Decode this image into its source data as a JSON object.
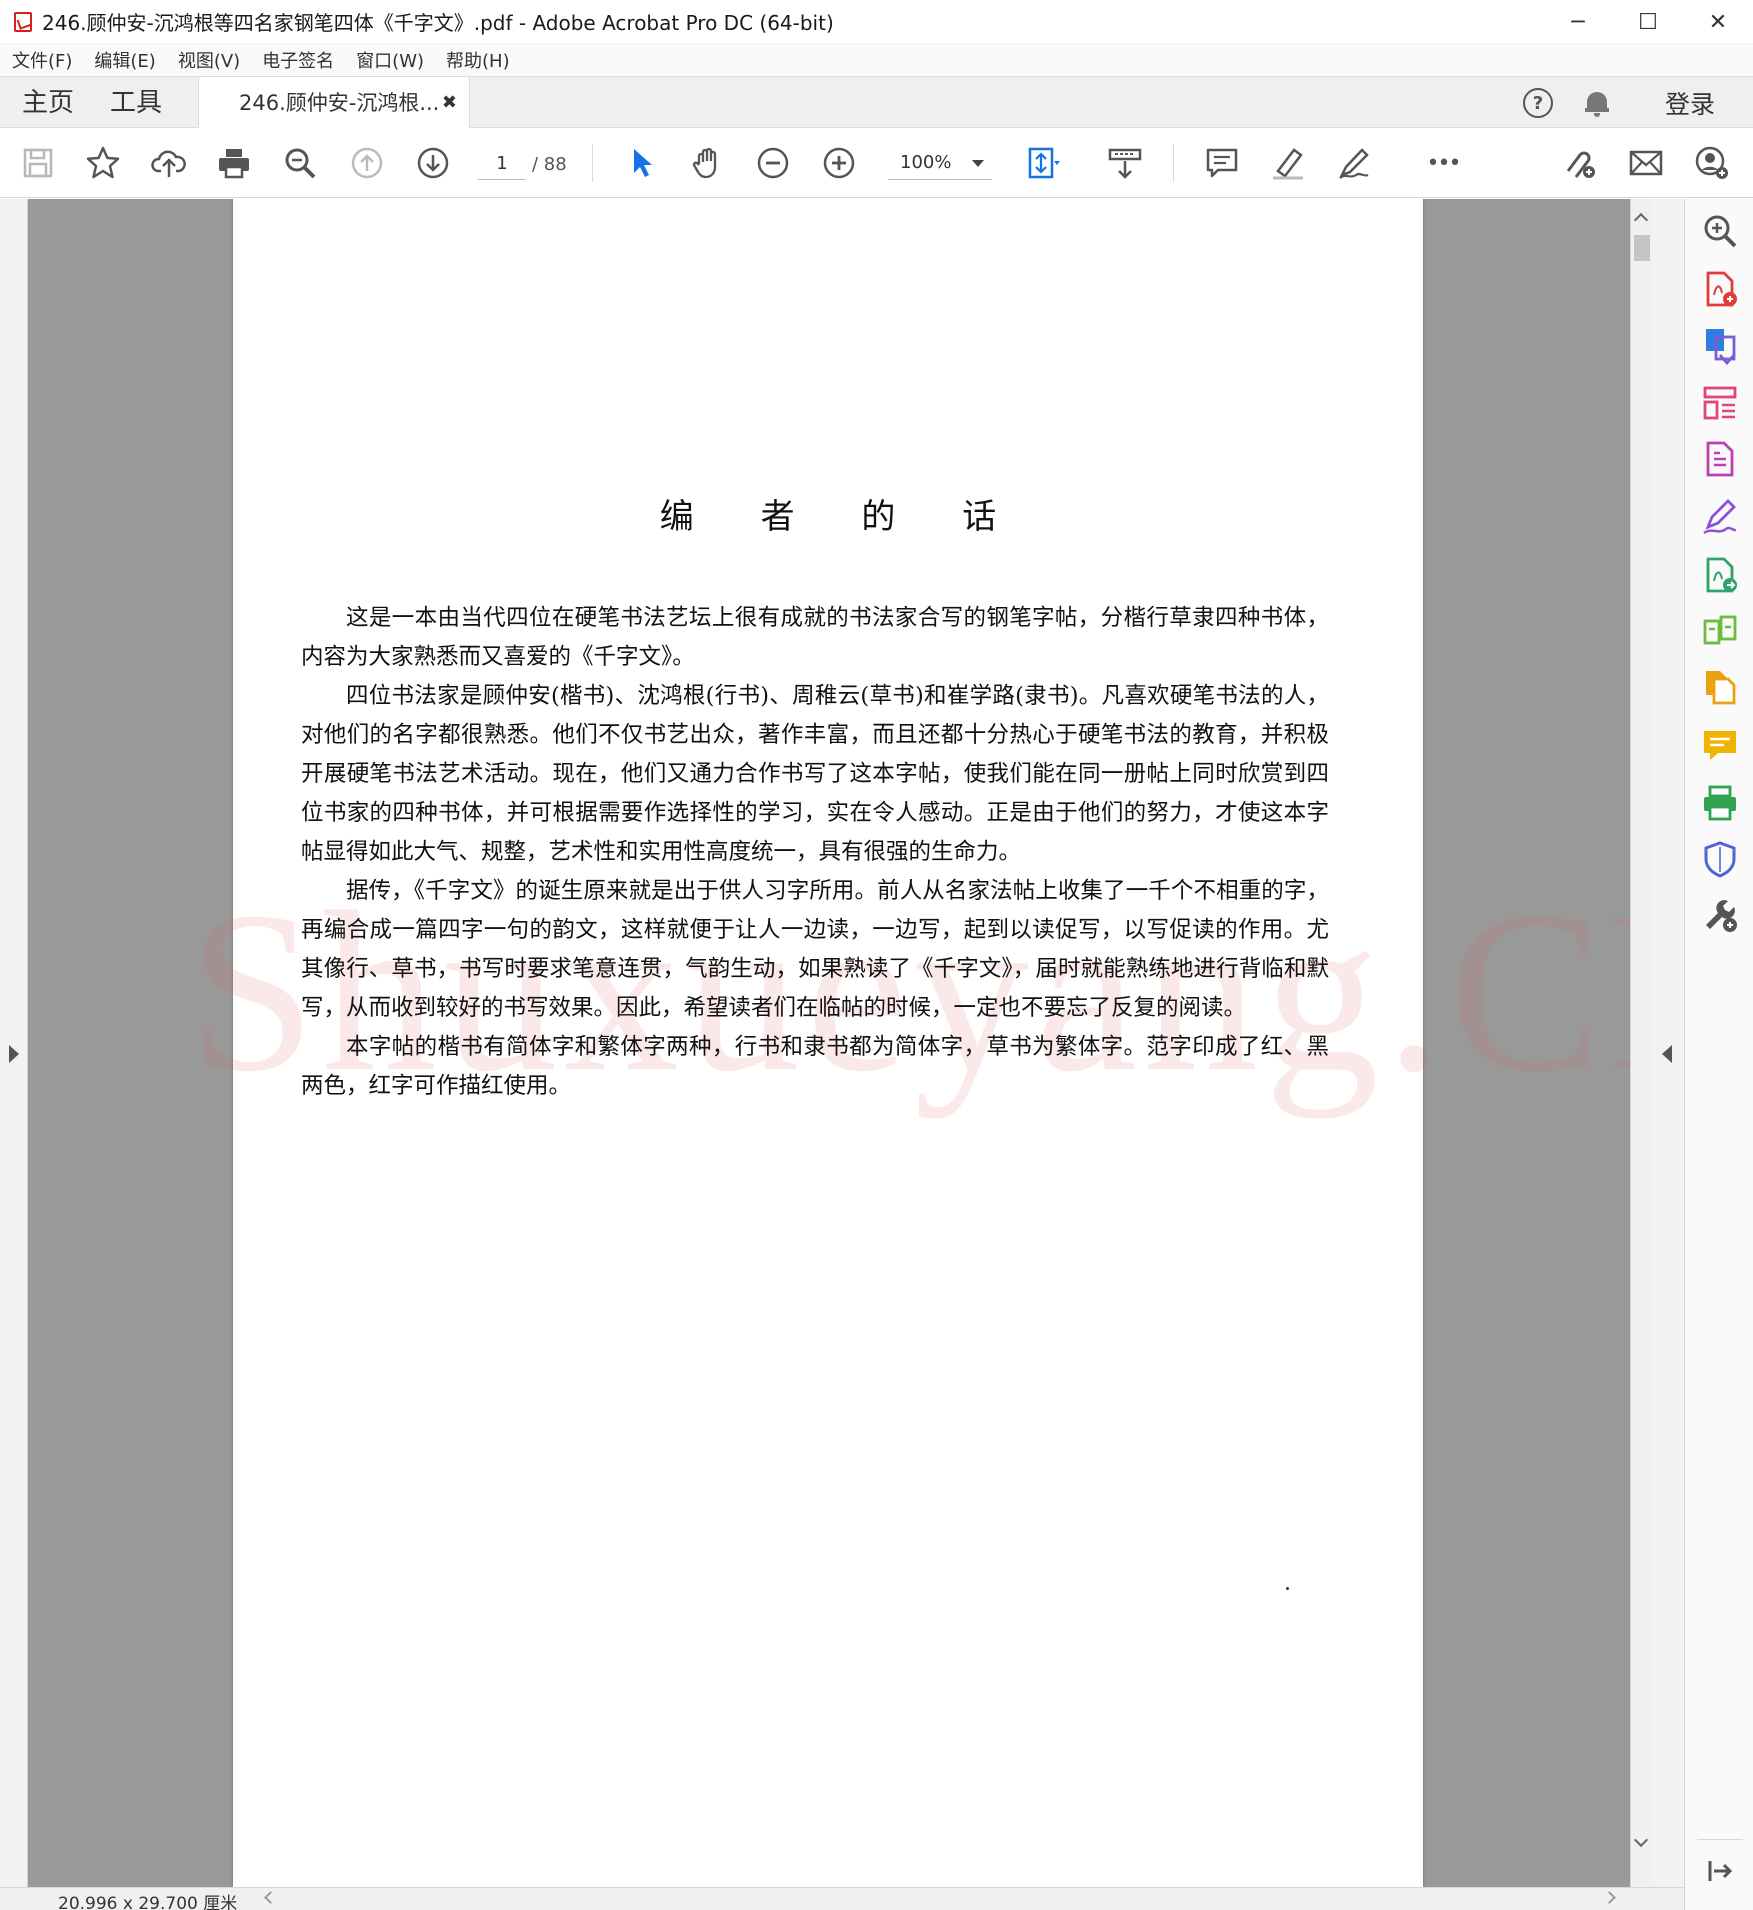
{
  "window": {
    "title": "246.顾仲安-沉鸿根等四名家钢笔四体《千字文》.pdf - Adobe Acrobat Pro DC (64-bit)",
    "minimize_glyph": "─",
    "maximize_glyph": "☐",
    "close_glyph": "✕"
  },
  "menu": [
    "文件(F)",
    "编辑(E)",
    "视图(V)",
    "电子签名",
    "窗口(W)",
    "帮助(H)"
  ],
  "tabs": {
    "home": "主页",
    "tools": "工具",
    "document": "246.顾仲安-沉鸿根...",
    "close_glyph": "✖",
    "help_glyph": "?",
    "login": "登录"
  },
  "toolbar": {
    "current_page": "1",
    "total_pages": "/ 88",
    "zoom": "100%",
    "more_glyph": "•••",
    "icons": [
      "save-icon",
      "star-icon",
      "cloud-upload-icon",
      "print-icon",
      "zoom-search-icon",
      "page-up-icon",
      "page-down-icon",
      "select-arrow-icon",
      "hand-icon",
      "zoom-out-icon",
      "zoom-in-icon",
      "fit-page-icon",
      "scroll-mode-icon",
      "comment-icon",
      "highlight-icon",
      "sign-icon",
      "more-icon",
      "share-link-icon",
      "email-icon",
      "add-user-icon"
    ],
    "accent": "#1473e6"
  },
  "document": {
    "heading": "编 者 的 话",
    "paragraphs": [
      "这是一本由当代四位在硬笔书法艺坛上很有成就的书法家合写的钢笔字帖，分楷行草隶四种书体，内容为大家熟悉而又喜爱的《千字文》。",
      "四位书法家是顾仲安(楷书)、沈鸿根(行书)、周稚云(草书)和崔学路(隶书)。凡喜欢硬笔书法的人，对他们的名字都很熟悉。他们不仅书艺出众，著作丰富，而且还都十分热心于硬笔书法的教育，并积极开展硬笔书法艺术活动。现在，他们又通力合作书写了这本字帖，使我们能在同一册帖上同时欣赏到四位书家的四种书体，并可根据需要作选择性的学习，实在令人感动。正是由于他们的努力，才使这本字帖显得如此大气、规整，艺术性和实用性高度统一，具有很强的生命力。",
      "据传，《千字文》的诞生原来就是出于供人习字所用。前人从名家法帖上收集了一千个不相重的字，再编合成一篇四字一句的韵文，这样就便于让人一边读，一边写，起到以读促写，以写促读的作用。尤其像行、草书，书写时要求笔意连贯，气韵生动，如果熟读了《千字文》，届时就能熟练地进行背临和默写，从而收到较好的书写效果。因此，希望读者们在临帖的时候，一定也不要忘了反复的阅读。",
      "本字帖的楷书有简体字和繁体字两种，行书和隶书都为简体字，草书为繁体字。范字印成了红、黑两色，红字可作描红使用。"
    ],
    "watermark": "Shuxueyang.CN"
  },
  "right_pane": {
    "icons": [
      {
        "name": "enhance-scan-icon",
        "color": "#555555"
      },
      {
        "name": "create-pdf-icon",
        "color": "#e03c3c"
      },
      {
        "name": "export-pdf-icon",
        "color": "#7b5bd6"
      },
      {
        "name": "organize-pages-icon",
        "color": "#e0457b"
      },
      {
        "name": "edit-pdf-icon",
        "color": "#c03fb5"
      },
      {
        "name": "fill-sign-icon",
        "color": "#8f4fd6"
      },
      {
        "name": "export-file-icon",
        "color": "#2fa36b"
      },
      {
        "name": "compare-files-icon",
        "color": "#6dbb3f"
      },
      {
        "name": "combine-files-icon",
        "color": "#e8a30f"
      },
      {
        "name": "comment-tool-icon",
        "color": "#f0b400"
      },
      {
        "name": "print-production-icon",
        "color": "#2fa34f"
      },
      {
        "name": "protect-icon",
        "color": "#5263d6"
      },
      {
        "name": "more-tools-icon",
        "color": "#555555"
      }
    ],
    "bottom_icon": "expand-pane-icon"
  },
  "status": {
    "page_size": "20.996 x 29.700 厘米"
  }
}
